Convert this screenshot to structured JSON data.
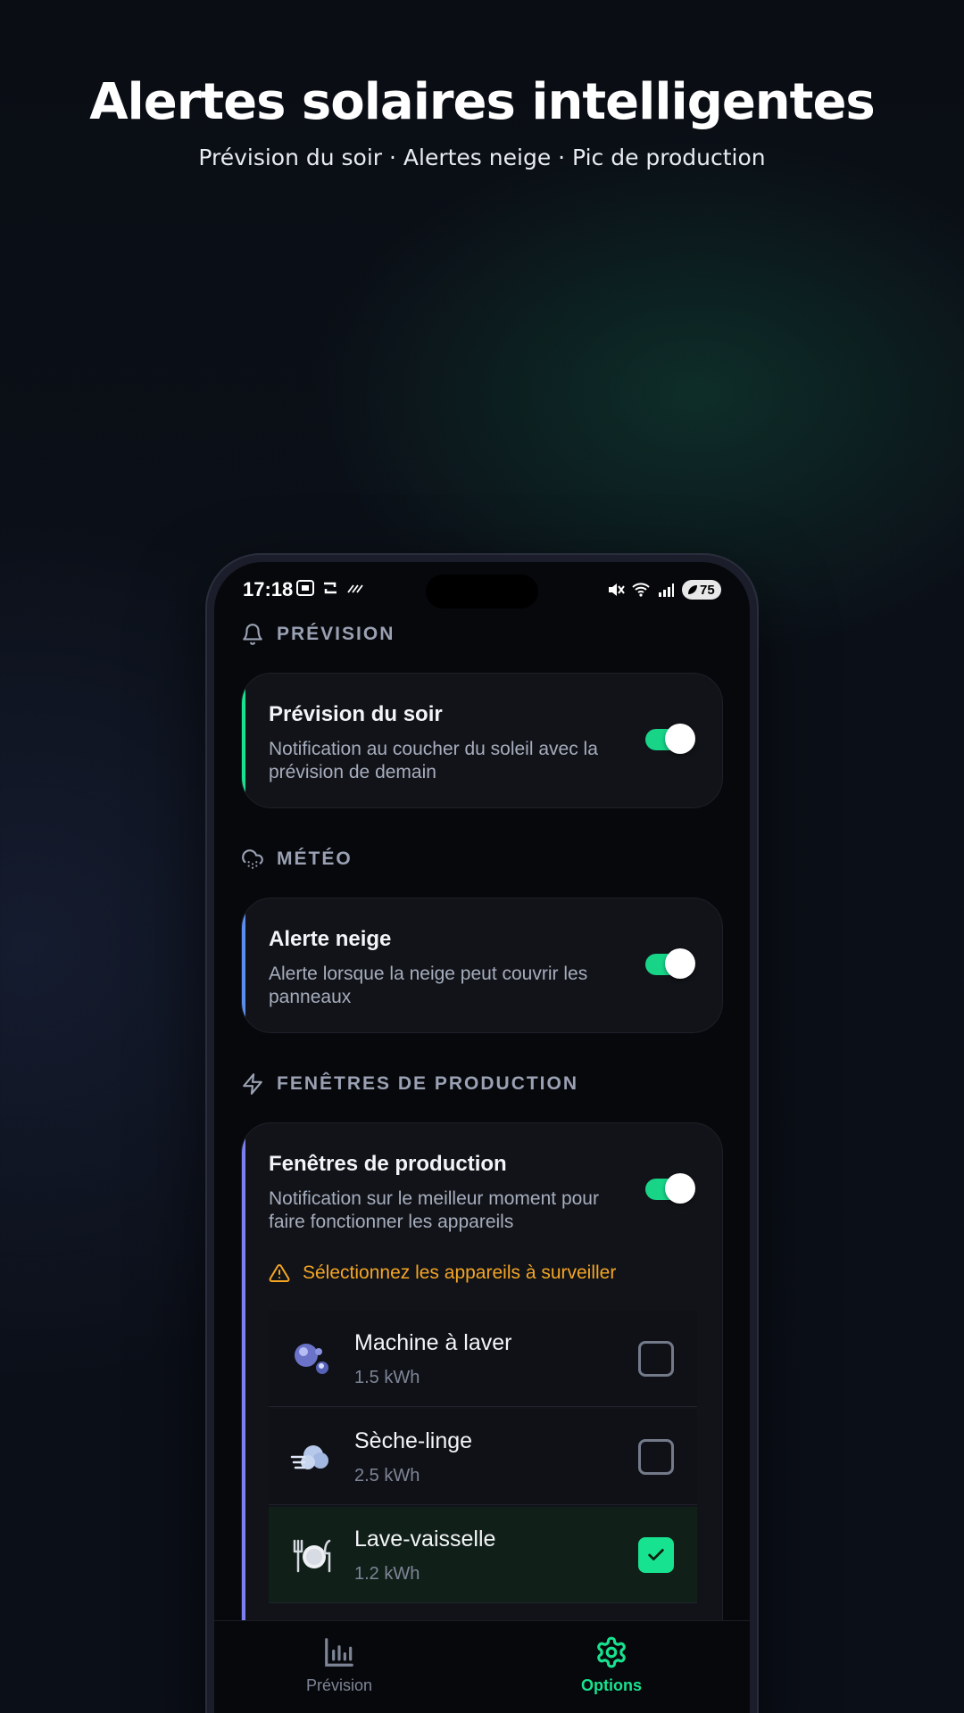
{
  "header": {
    "title": "Alertes solaires intelligentes",
    "subtitle": "Prévision du soir · Alertes neige · Pic de production"
  },
  "status_bar": {
    "time": "17:18",
    "battery": "75"
  },
  "sections": {
    "prevision": {
      "label": "PRÉVISION",
      "card": {
        "title": "Prévision du soir",
        "description": "Notification au coucher du soleil avec la prévision de demain",
        "enabled": true,
        "accent": "#17e28f"
      }
    },
    "meteo": {
      "label": "MÉTÉO",
      "card": {
        "title": "Alerte neige",
        "description": "Alerte lorsque la neige peut couvrir les panneaux",
        "enabled": true,
        "accent": "#5b8def"
      }
    },
    "production": {
      "label": "FENÊTRES DE PRODUCTION",
      "card": {
        "title": "Fenêtres de production",
        "description": "Notification sur le meilleur moment pour faire fonctionner les appareils",
        "enabled": true,
        "accent": "#7b7ff0",
        "warning": "Sélectionnez les appareils à surveiller",
        "appliances": [
          {
            "name": "Machine à laver",
            "energy": "1.5 kWh",
            "checked": false,
            "icon": "washing-bubbles-icon"
          },
          {
            "name": "Sèche-linge",
            "energy": "2.5 kWh",
            "checked": false,
            "icon": "wind-cloud-icon"
          },
          {
            "name": "Lave-vaisselle",
            "energy": "1.2 kWh",
            "checked": true,
            "icon": "plate-cutlery-icon"
          }
        ]
      }
    }
  },
  "nav": {
    "items": [
      {
        "label": "Prévision",
        "icon": "bar-chart-icon",
        "active": false
      },
      {
        "label": "Options",
        "icon": "gear-icon",
        "active": true
      }
    ]
  },
  "colors": {
    "accent_green": "#17e28f",
    "warning": "#f5a524",
    "background": "#07080c"
  }
}
